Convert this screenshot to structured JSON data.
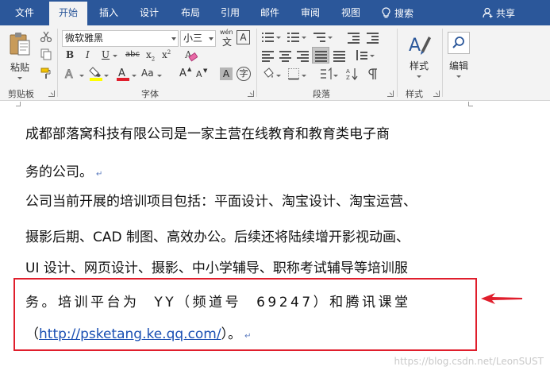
{
  "tabs": [
    {
      "label": "文件",
      "active": false
    },
    {
      "label": "开始",
      "active": true
    },
    {
      "label": "插入",
      "active": false
    },
    {
      "label": "设计",
      "active": false
    },
    {
      "label": "布局",
      "active": false
    },
    {
      "label": "引用",
      "active": false
    },
    {
      "label": "邮件",
      "active": false
    },
    {
      "label": "审阅",
      "active": false
    },
    {
      "label": "视图",
      "active": false
    }
  ],
  "search_label": "搜索",
  "share_label": "共享",
  "clipboard": {
    "paste_label": "粘贴",
    "group_label": "剪贴板"
  },
  "font": {
    "name": "微软雅黑",
    "size": "小三",
    "wen_glyph": "wén",
    "wen_base": "文",
    "boxed_a": "A",
    "bold": "B",
    "italic": "I",
    "underline": "U",
    "strike": "abc",
    "subscript": "x",
    "superscript": "x",
    "subscript_mark": "2",
    "superscript_mark": "2",
    "grow": "A",
    "shrink": "A",
    "caps": "Aa",
    "char_shading": "A",
    "enclose": "字",
    "group_label": "字体"
  },
  "paragraph": {
    "group_label": "段落"
  },
  "styles": {
    "label": "样式",
    "group_label": "样式"
  },
  "editing": {
    "label": "编辑"
  },
  "colors": {
    "tab_bar": "#2b579a",
    "highlight": "#ffff00",
    "font_color": "#e01e2c",
    "box": "#e01e2c",
    "link": "#1a4fb3"
  },
  "document": {
    "lines": [
      "成都部落窝科技有限公司是一家主营在线教育和教育类电子商",
      "务的公司。",
      "公司当前开展的培训项目包括：平面设计、淘宝设计、淘宝运营、",
      "摄影后期、CAD 制图、高效办公。后续还将陆续增开影视动画、",
      "UI 设计、网页设计、摄影、中小学辅导、职称考试辅导等培训服",
      "务。培训平台为 YY（频道号 69247）和腾讯课堂",
      "（",
      "http://psketang.ke.qq.com/",
      "）。"
    ],
    "paragraph_mark": "↵"
  },
  "watermark": "https://blog.csdn.net/LeonSUST"
}
